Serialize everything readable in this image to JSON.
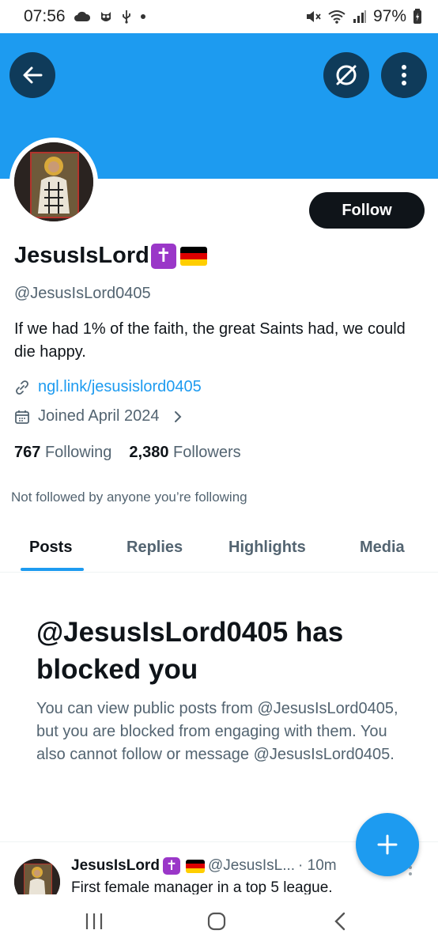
{
  "status_bar": {
    "time": "07:56",
    "battery": "97%"
  },
  "profile": {
    "display_name": "JesusIsLord",
    "handle": "@JesusIsLord0405",
    "bio": "If we had 1% of the faith, the great Saints had, we could die happy.",
    "link": "ngl.link/jesusislord0405",
    "joined": "Joined April 2024",
    "following_count": "767",
    "following_label": "Following",
    "followers_count": "2,380",
    "followers_label": "Followers",
    "not_followed": "Not followed by anyone you’re following",
    "follow_button": "Follow"
  },
  "tabs": [
    {
      "label": "Posts",
      "active": true
    },
    {
      "label": "Replies",
      "active": false
    },
    {
      "label": "Highlights",
      "active": false
    },
    {
      "label": "Media",
      "active": false
    }
  ],
  "blocked": {
    "title": "@JesusIsLord0405 has blocked you",
    "description": "You can view public posts from @JesusIsLord0405, but you are blocked from engaging with them. You also cannot follow or message @JesusIsLord0405."
  },
  "post": {
    "name": "JesusIsLord",
    "handle": "@JesusIsL...",
    "time": "· 10m",
    "text": "First female manager in a top 5 league."
  },
  "colors": {
    "accent": "#1d9bf0",
    "banner": "#1d9bf0",
    "button_dark": "#0f1419",
    "secondary_text": "#536471"
  },
  "icons": {
    "back": "arrow-left-icon",
    "grok": "grok-icon",
    "more": "more-vertical-icon",
    "link": "link-icon",
    "calendar": "calendar-icon",
    "compose": "plus-icon"
  }
}
